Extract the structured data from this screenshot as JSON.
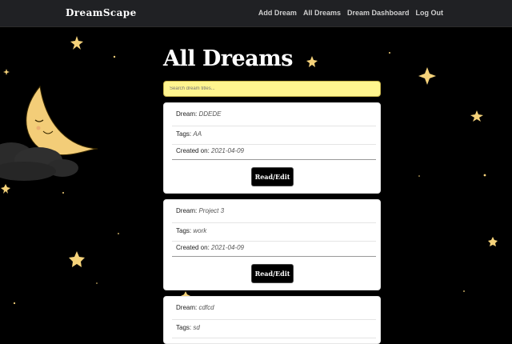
{
  "nav": {
    "brand": "DreamScape",
    "links": [
      "Add Dream",
      "All Dreams",
      "Dream Dashboard",
      "Log Out"
    ]
  },
  "page": {
    "title": "All Dreams"
  },
  "search": {
    "placeholder": "Search dream titles..."
  },
  "labels": {
    "dream": "Dream:",
    "tags": "Tags:",
    "created": "Created on:",
    "button": "Read/Edit"
  },
  "dreams": [
    {
      "title": "DDEDE",
      "tags": "AA",
      "created": "2021-04-09"
    },
    {
      "title": "Project 3",
      "tags": "work",
      "created": "2021-04-09"
    },
    {
      "title": "cdfcd",
      "tags": "sd"
    }
  ],
  "colors": {
    "background": "#000000",
    "star": "#f5d27a",
    "search": "#fff58f"
  }
}
